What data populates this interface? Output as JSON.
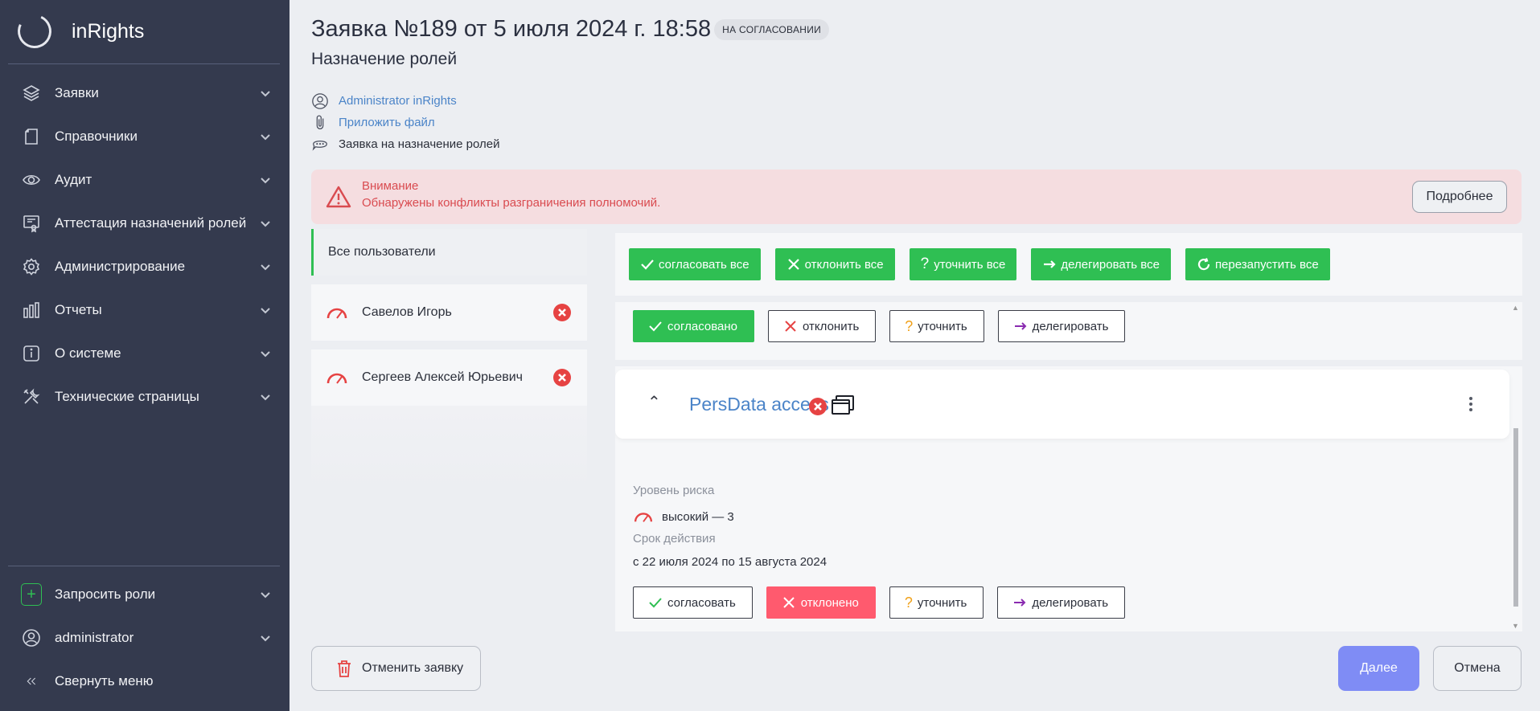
{
  "app": {
    "name": "inRights"
  },
  "sidebar": {
    "items": [
      {
        "label": "Заявки",
        "icon": "layers-icon"
      },
      {
        "label": "Справочники",
        "icon": "book-icon"
      },
      {
        "label": "Аудит",
        "icon": "eye-icon"
      },
      {
        "label": "Аттестация назначений ролей",
        "icon": "certificate-icon"
      },
      {
        "label": "Администрирование",
        "icon": "gear-icon"
      },
      {
        "label": "Отчеты",
        "icon": "bar-chart-icon"
      },
      {
        "label": "О системе",
        "icon": "info-icon"
      },
      {
        "label": "Технические страницы",
        "icon": "tools-icon"
      }
    ],
    "bottom": {
      "request_roles": "Запросить роли",
      "user": "administrator",
      "collapse": "Свернуть меню"
    }
  },
  "request": {
    "title": "Заявка №189 от 5 июля 2024 г. 18:58",
    "status": "НА СОГЛАСОВАНИИ",
    "subtitle": "Назначение ролей",
    "author": "Administrator inRights",
    "attach": "Приложить файл",
    "comment": "Заявка на назначение ролей"
  },
  "alert": {
    "title": "Внимание",
    "text": "Обнаружены конфликты разграничения полномочий.",
    "more": "Подробнее"
  },
  "users": {
    "all": "Все пользователи",
    "list": [
      {
        "name": "Савелов Игорь"
      },
      {
        "name": "Сергеев Алексей Юрьевич"
      }
    ]
  },
  "bulk_actions": {
    "approve_all": "согласовать все",
    "reject_all": "отклонить все",
    "clarify_all": "уточнить все",
    "delegate_all": "делегировать все",
    "restart_all": "перезапустить все"
  },
  "card1": {
    "approved": "согласовано",
    "reject": "отклонить",
    "clarify": "уточнить",
    "delegate": "делегировать"
  },
  "role": {
    "name": "PersData access",
    "risk_label": "Уровень риска",
    "risk_value": "высокий — 3",
    "period_label": "Срок действия",
    "period_value": "с 22 июля 2024 по 15 августа 2024",
    "approve": "согласовать",
    "rejected": "отклонено",
    "clarify": "уточнить",
    "delegate": "делегировать"
  },
  "footer": {
    "cancel_request": "Отменить заявку",
    "next": "Далее",
    "cancel": "Отмена"
  },
  "colors": {
    "sidebar_bg": "#343a4e",
    "green": "#2fbf53",
    "red": "#e64343",
    "rejected_bg": "#ff5a6e",
    "link": "#4b84c8",
    "next_bg": "#7f8cf5",
    "alert_bg": "#f5dde0"
  }
}
